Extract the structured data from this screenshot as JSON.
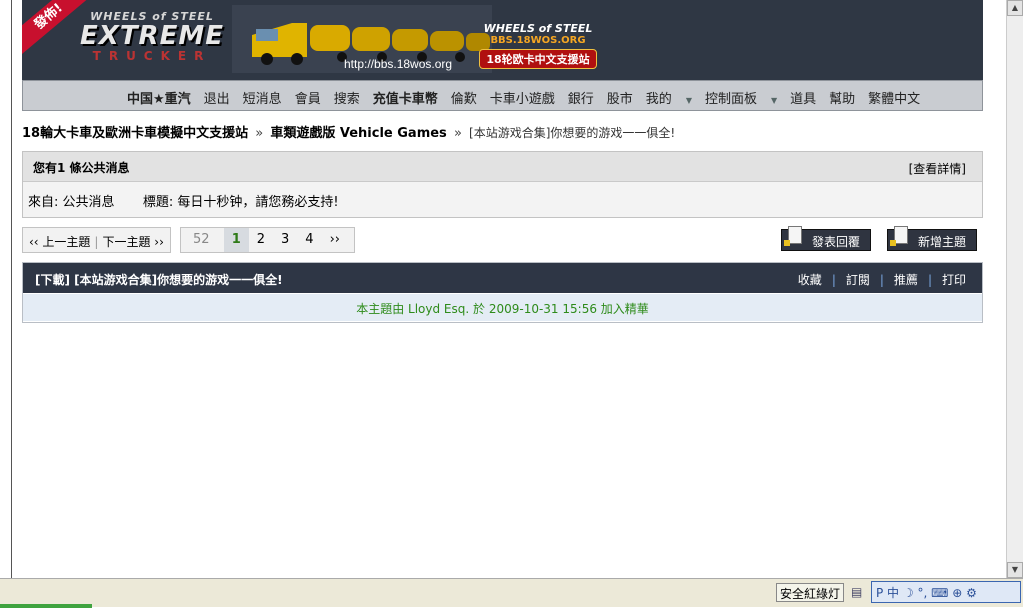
{
  "banner": {
    "corner_badge": "發佈!",
    "logo_top": "WHEELS of STEEL",
    "logo_main": "EXTREME",
    "logo_sub": "TRUCKER",
    "url": "http://bbs.18wos.org",
    "logo2_title": "WHEELS of STEEL",
    "logo2_site": "BBS.18WOS.ORG",
    "logo2_cn": "18轮欧卡中文支援站"
  },
  "nav": {
    "items": [
      "中国★重汽",
      "退出",
      "短消息",
      "會員",
      "搜索",
      "充值卡車幣",
      "倫歎",
      "卡車小遊戲",
      "銀行",
      "股市",
      "我的",
      "控制面板",
      "道具",
      "幫助",
      "繁體中文"
    ]
  },
  "breadcrumb": {
    "home": "18輪大卡車及歐洲卡車模擬中文支援站",
    "sep": "»",
    "forum": "車類遊戲版 Vehicle Games",
    "current": "[本站游戏合集]你想要的游戏一一俱全!"
  },
  "pm": {
    "title": "您有1 條公共消息",
    "more": "[查看詳情]",
    "from_label": "來自:",
    "from": "公共消息",
    "subject_label": "標題:",
    "subject": "每日十秒钟，請您務必支持!"
  },
  "pager": {
    "prev": "‹‹ 上一主題",
    "next": "下一主題 ››",
    "first": "52",
    "pages": [
      "1",
      "2",
      "3",
      "4"
    ],
    "current_page": "1",
    "next_arrow": "››"
  },
  "buttons": {
    "reply": "發表回覆",
    "new_topic": "新增主題"
  },
  "thread": {
    "title": "[下載] [本站游戏合集]你想要的游戏一一俱全!",
    "actions": [
      "收藏",
      "訂閱",
      "推薦",
      "打印"
    ],
    "note": "本主題由 Lloyd Esq. 於 2009-10-31 15:56 加入精華"
  },
  "statusbar": {
    "safe_light": "安全紅綠灯",
    "ime": "P 中 ☽ °, ⌨ ⊕ ⚙"
  },
  "colors": {
    "banner_bg": "#2f3744",
    "nav_bg": "#c9ccd1",
    "thread_head": "#2e3645",
    "note_text": "#2e8b1a"
  }
}
